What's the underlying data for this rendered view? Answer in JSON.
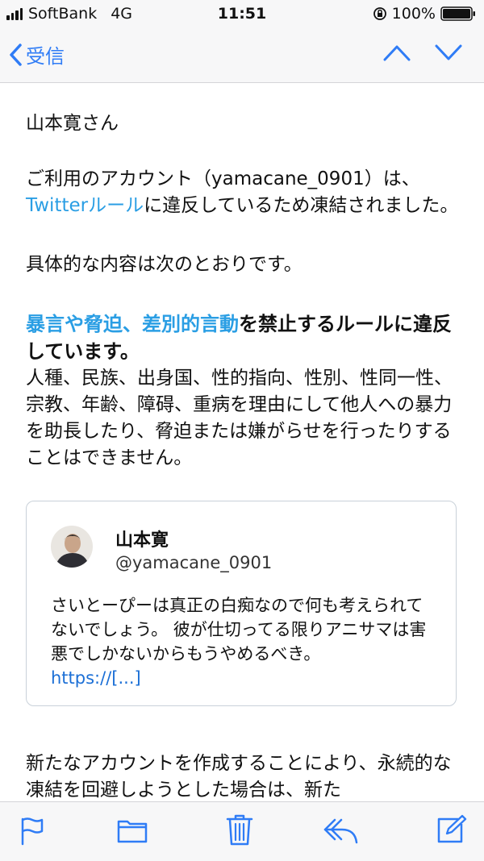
{
  "status": {
    "carrier": "SoftBank",
    "network": "4G",
    "time": "11:51",
    "battery": "100%"
  },
  "nav": {
    "back_label": "受信"
  },
  "mail": {
    "greeting": "山本寛さん",
    "intro_before": "ご利用のアカウント（yamacane_0901）は、",
    "intro_link": "Twitterルール",
    "intro_after": "に違反しているため凍結されました。",
    "details_intro": "具体的な内容は次のとおりです。",
    "rule_link": "暴言や脅迫、差別的言動",
    "rule_text": "を禁止するルールに違反しています。",
    "rule_description": "人種、民族、出身国、性的指向、性別、性同一性、宗教、年齢、障碍、重病を理由にして他人への暴力を助長したり、脅迫または嫌がらせを行ったりすることはできません。",
    "footer_text": "新たなアカウントを作成することにより、永続的な凍結を回避しようとした場合は、新た"
  },
  "tweet": {
    "name": "山本寛",
    "handle": "@yamacane_0901",
    "text": "さいとーぴーは真正の白痴なので何も考えられてないでしょう。 彼が仕切ってる限りアニサマは害悪でしかないからもうやめるべき。",
    "url": "https://[...]"
  },
  "icons": {
    "accent": "#2f7cf6",
    "toolbar": [
      "flag-icon",
      "folder-icon",
      "trash-icon",
      "reply-icon",
      "compose-icon"
    ]
  }
}
